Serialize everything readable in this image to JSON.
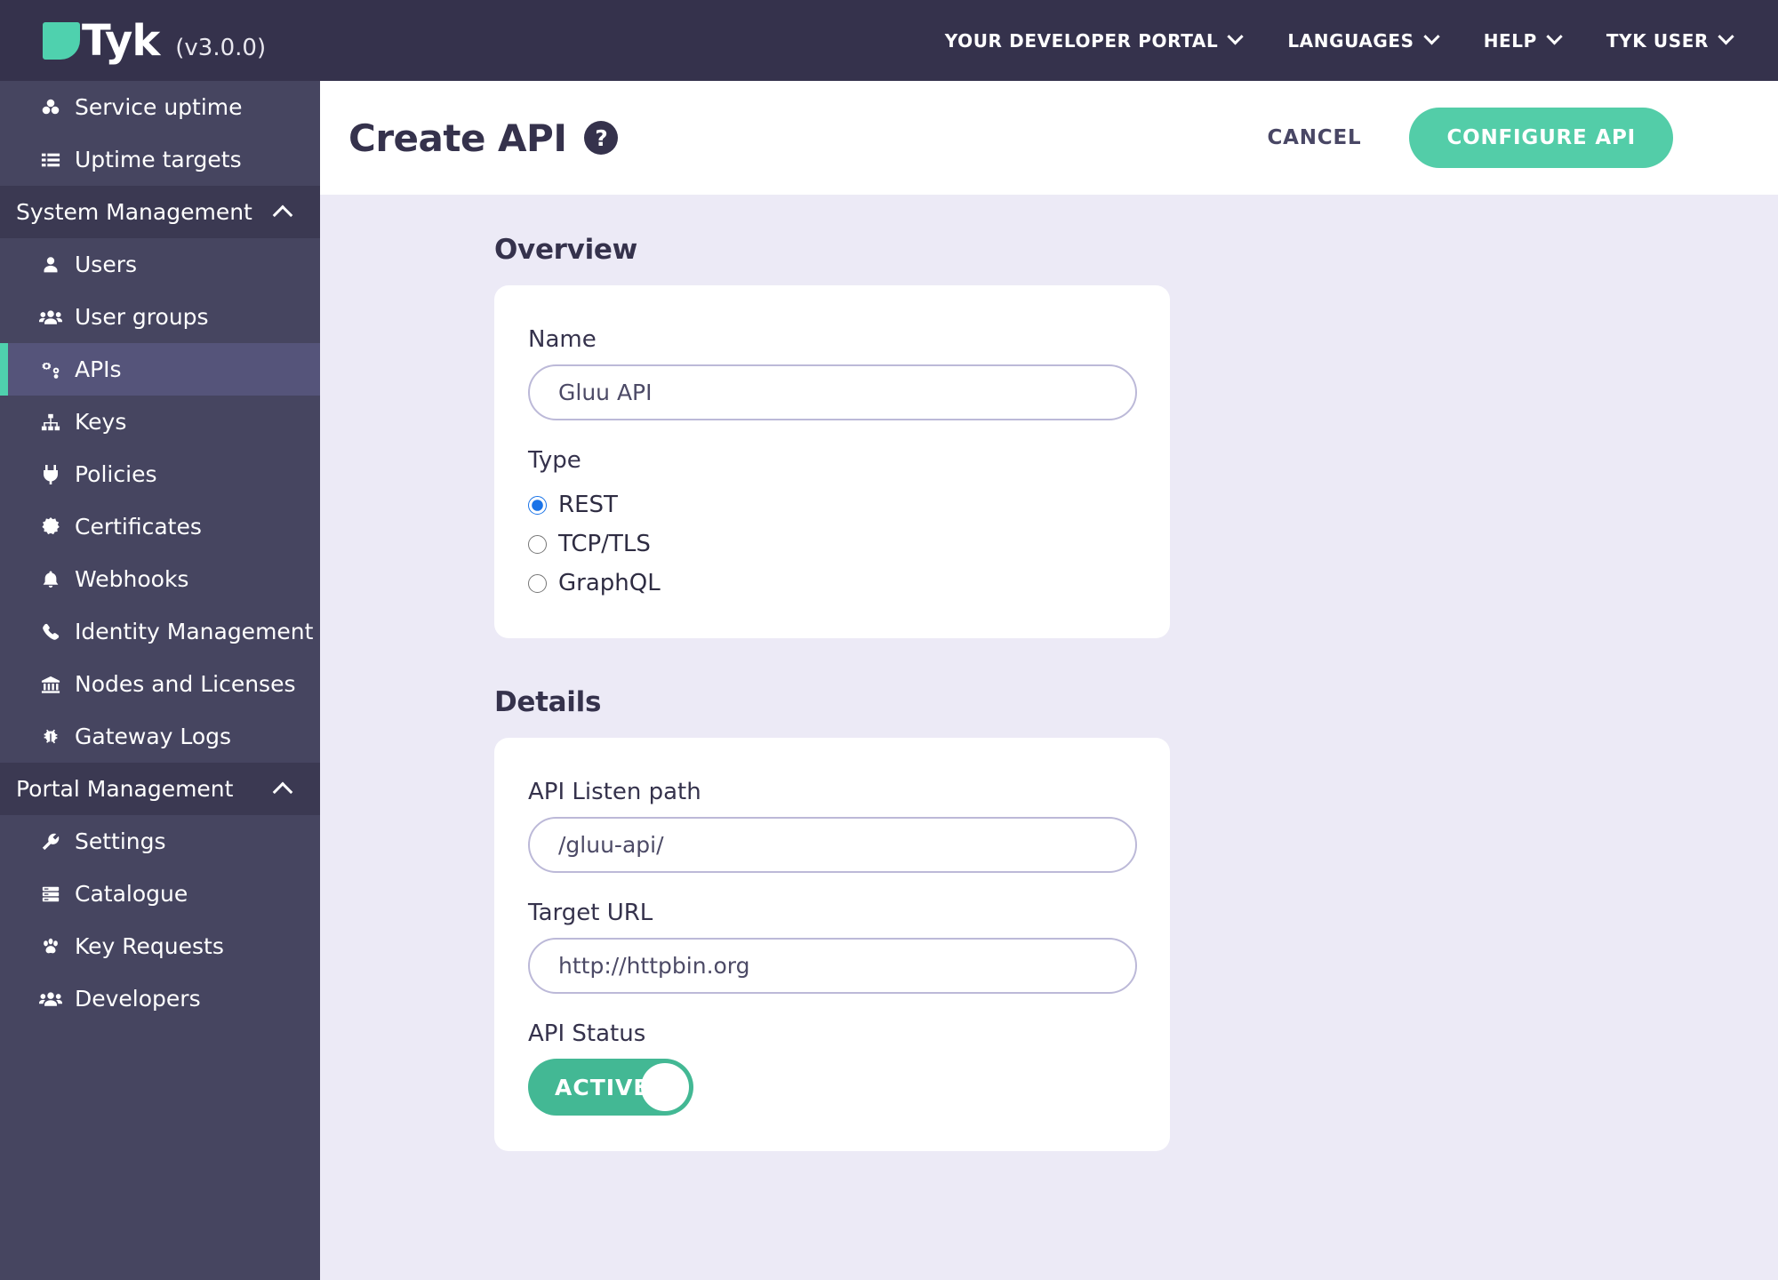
{
  "topbar": {
    "logo_text": "Tyk",
    "version": "(v3.0.0)",
    "nav": [
      {
        "label": "YOUR DEVELOPER PORTAL",
        "icon": "chevron-down-icon"
      },
      {
        "label": "LANGUAGES",
        "icon": "chevron-down-icon"
      },
      {
        "label": "HELP",
        "icon": "chevron-down-icon"
      },
      {
        "label": "TYK USER",
        "icon": "chevron-down-icon"
      }
    ]
  },
  "sidebar": {
    "items": [
      {
        "label": "Service uptime",
        "icon": "cubes-icon",
        "type": "item",
        "active": false
      },
      {
        "label": "Uptime targets",
        "icon": "list-icon",
        "type": "item",
        "active": false
      },
      {
        "label": "System Management",
        "icon": "caret-up-icon",
        "type": "section"
      },
      {
        "label": "Users",
        "icon": "user-icon",
        "type": "item",
        "active": false
      },
      {
        "label": "User groups",
        "icon": "users-icon",
        "type": "item",
        "active": false
      },
      {
        "label": "APIs",
        "icon": "cogs-icon",
        "type": "item",
        "active": true
      },
      {
        "label": "Keys",
        "icon": "sitemap-icon",
        "type": "item",
        "active": false
      },
      {
        "label": "Policies",
        "icon": "plug-icon",
        "type": "item",
        "active": false
      },
      {
        "label": "Certificates",
        "icon": "certificate-icon",
        "type": "item",
        "active": false
      },
      {
        "label": "Webhooks",
        "icon": "bell-icon",
        "type": "item",
        "active": false
      },
      {
        "label": "Identity Management",
        "icon": "phone-icon",
        "type": "item",
        "active": false
      },
      {
        "label": "Nodes and Licenses",
        "icon": "bank-icon",
        "type": "item",
        "active": false
      },
      {
        "label": "Gateway Logs",
        "icon": "bug-icon",
        "type": "item",
        "active": false
      },
      {
        "label": "Portal Management",
        "icon": "caret-up-icon",
        "type": "section"
      },
      {
        "label": "Settings",
        "icon": "wrench-icon",
        "type": "item",
        "active": false
      },
      {
        "label": "Catalogue",
        "icon": "server-icon",
        "type": "item",
        "active": false
      },
      {
        "label": "Key Requests",
        "icon": "paw-icon",
        "type": "item",
        "active": false
      },
      {
        "label": "Developers",
        "icon": "users-icon",
        "type": "item",
        "active": false
      }
    ]
  },
  "page": {
    "title": "Create API",
    "help_icon_label": "?",
    "cancel_label": "CANCEL",
    "configure_label": "CONFIGURE API"
  },
  "overview": {
    "section_title": "Overview",
    "name_label": "Name",
    "name_value": "Gluu API",
    "type_label": "Type",
    "type_options": [
      {
        "label": "REST",
        "selected": true
      },
      {
        "label": "TCP/TLS",
        "selected": false
      },
      {
        "label": "GraphQL",
        "selected": false
      }
    ]
  },
  "details": {
    "section_title": "Details",
    "listen_path_label": "API Listen path",
    "listen_path_value": "/gluu-api/",
    "target_url_label": "Target URL",
    "target_url_value": "http://httpbin.org",
    "api_status_label": "API Status",
    "api_status_value": "ACTIVE"
  },
  "colors": {
    "topbar_bg": "#35324c",
    "sidebar_bg": "#464560",
    "sidebar_section_bg": "#3b3952",
    "sidebar_active_bg": "#55547a",
    "accent_teal": "#4fd1ae",
    "primary_button": "#53cda8",
    "toggle_green": "#43b894",
    "content_bg": "#eceaf6",
    "radio_blue": "#1a73e8",
    "input_border": "#bcb9d8"
  }
}
